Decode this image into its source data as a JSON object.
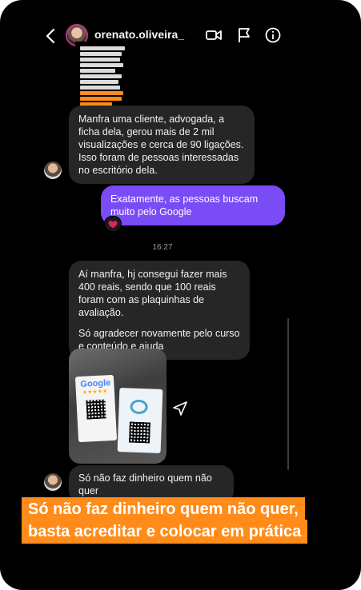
{
  "header": {
    "username": "orenato.oliveira_",
    "icons": [
      "back-icon",
      "video-call-icon",
      "flag-icon",
      "info-icon"
    ]
  },
  "messages": {
    "msg1": "Manfra uma cliente, advogada, a ficha dela, gerou mais de 2 mil visualizações e cerca de 90 ligações. Isso foram de pessoas interessadas no escritório dela.",
    "msg2": "Exatamente, as pessoas buscam muito pelo Google",
    "reaction": "❤️",
    "timestamp": "16:27",
    "msg3a": "Aí manfra, hj consegui fazer mais 400 reais, sendo que 100 reais foram com as plaquinhas de avaliação.",
    "msg3b": "Só agradecer novamente pelo curso e conteúdo e ajuda",
    "photo": {
      "google_label": "Google",
      "stars": "★★★★★"
    },
    "msg4": "Só não faz dinheiro quem não quer"
  },
  "caption": {
    "line1": "Só não faz dinheiro quem não quer,",
    "line2": "basta acreditar e colocar em prática"
  },
  "colors": {
    "outgoing_bubble": "#7a4cf6",
    "incoming_bubble": "#262626",
    "caption_bg": "#ff8c1a"
  }
}
